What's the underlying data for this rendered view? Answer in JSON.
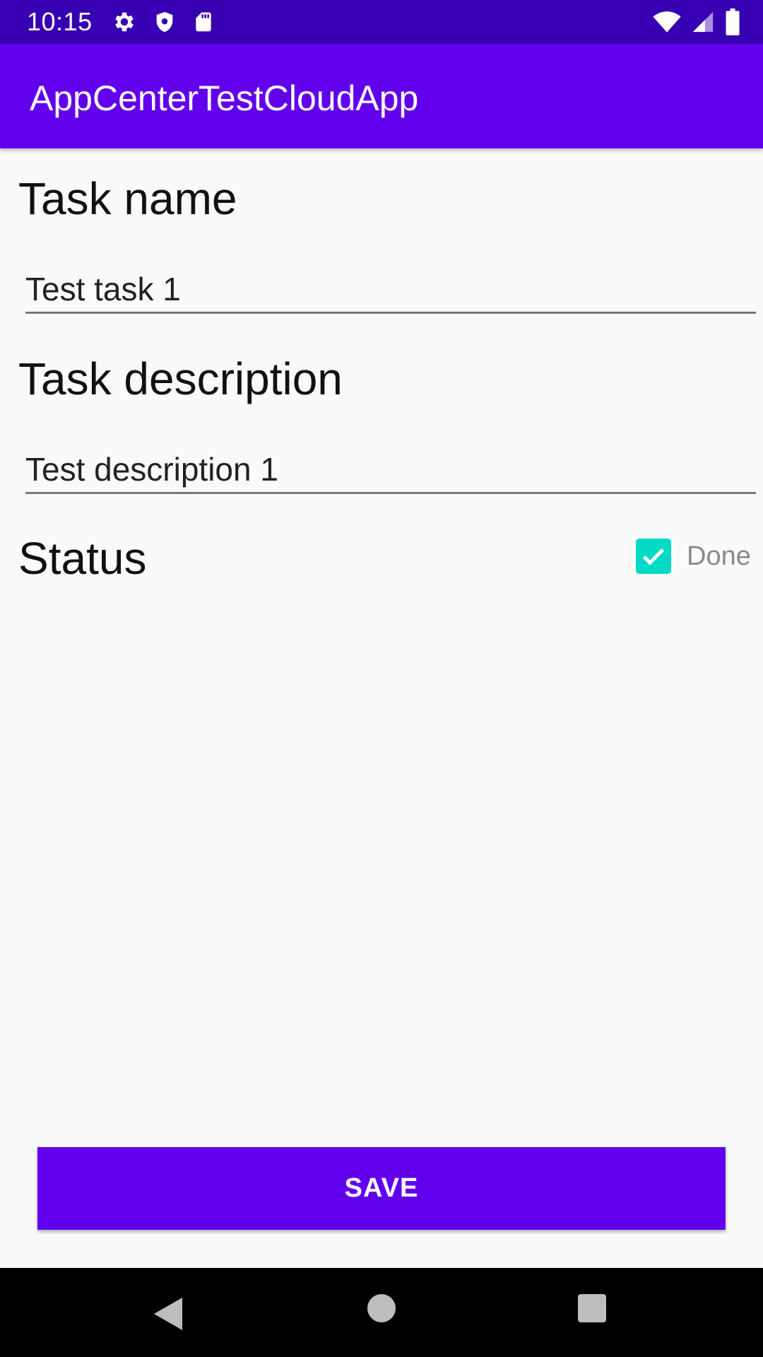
{
  "status_bar": {
    "time": "10:15",
    "left_icons": [
      "gear-icon",
      "shield-icon",
      "sd-card-icon"
    ],
    "right_icons": [
      "wifi-icon",
      "signal-icon",
      "battery-icon"
    ]
  },
  "app_bar": {
    "title": "AppCenterTestCloudApp"
  },
  "form": {
    "task_name_label": "Task name",
    "task_name_value": "Test task 1",
    "task_description_label": "Task description",
    "task_description_value": "Test description 1",
    "status_label": "Status",
    "done_checkbox": {
      "label": "Done",
      "checked": true
    }
  },
  "save_button_label": "SAVE",
  "colors": {
    "status_bar": "#3700b3",
    "primary": "#6200ee",
    "checkbox": "#03dac5",
    "background": "#fafafa"
  },
  "nav_bar": {
    "icons": [
      "back-icon",
      "home-icon",
      "recents-icon"
    ]
  }
}
